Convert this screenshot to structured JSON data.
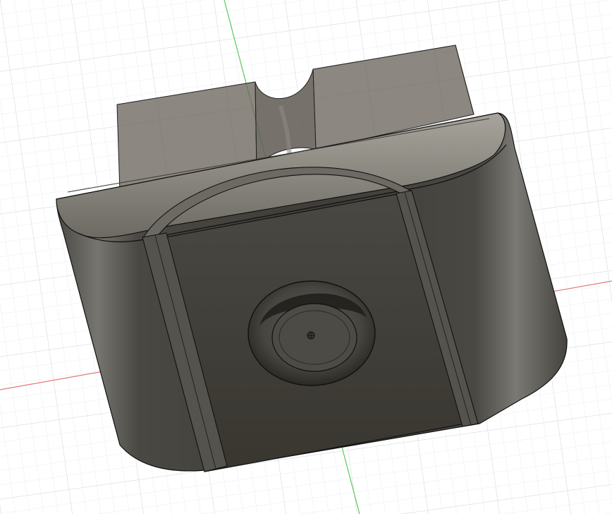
{
  "viewport": {
    "name": "3d-model-viewport",
    "colors": {
      "background": "#ffffff",
      "grid_minor": "#eef0f2",
      "grid_major": "#d6dadf",
      "axis_x": "#e06666",
      "axis_y": "#4caf50",
      "body_dark": "#3e3c37",
      "body_mid": "#5c5a54",
      "body_light": "#8f8d86",
      "translucent": "#6b655c",
      "edge": "#111111"
    }
  },
  "model": {
    "parts": [
      "back-wall",
      "notch",
      "main-body",
      "top-rim",
      "left-strap",
      "right-strap",
      "arch-strap",
      "center-recess",
      "origin-point"
    ]
  }
}
